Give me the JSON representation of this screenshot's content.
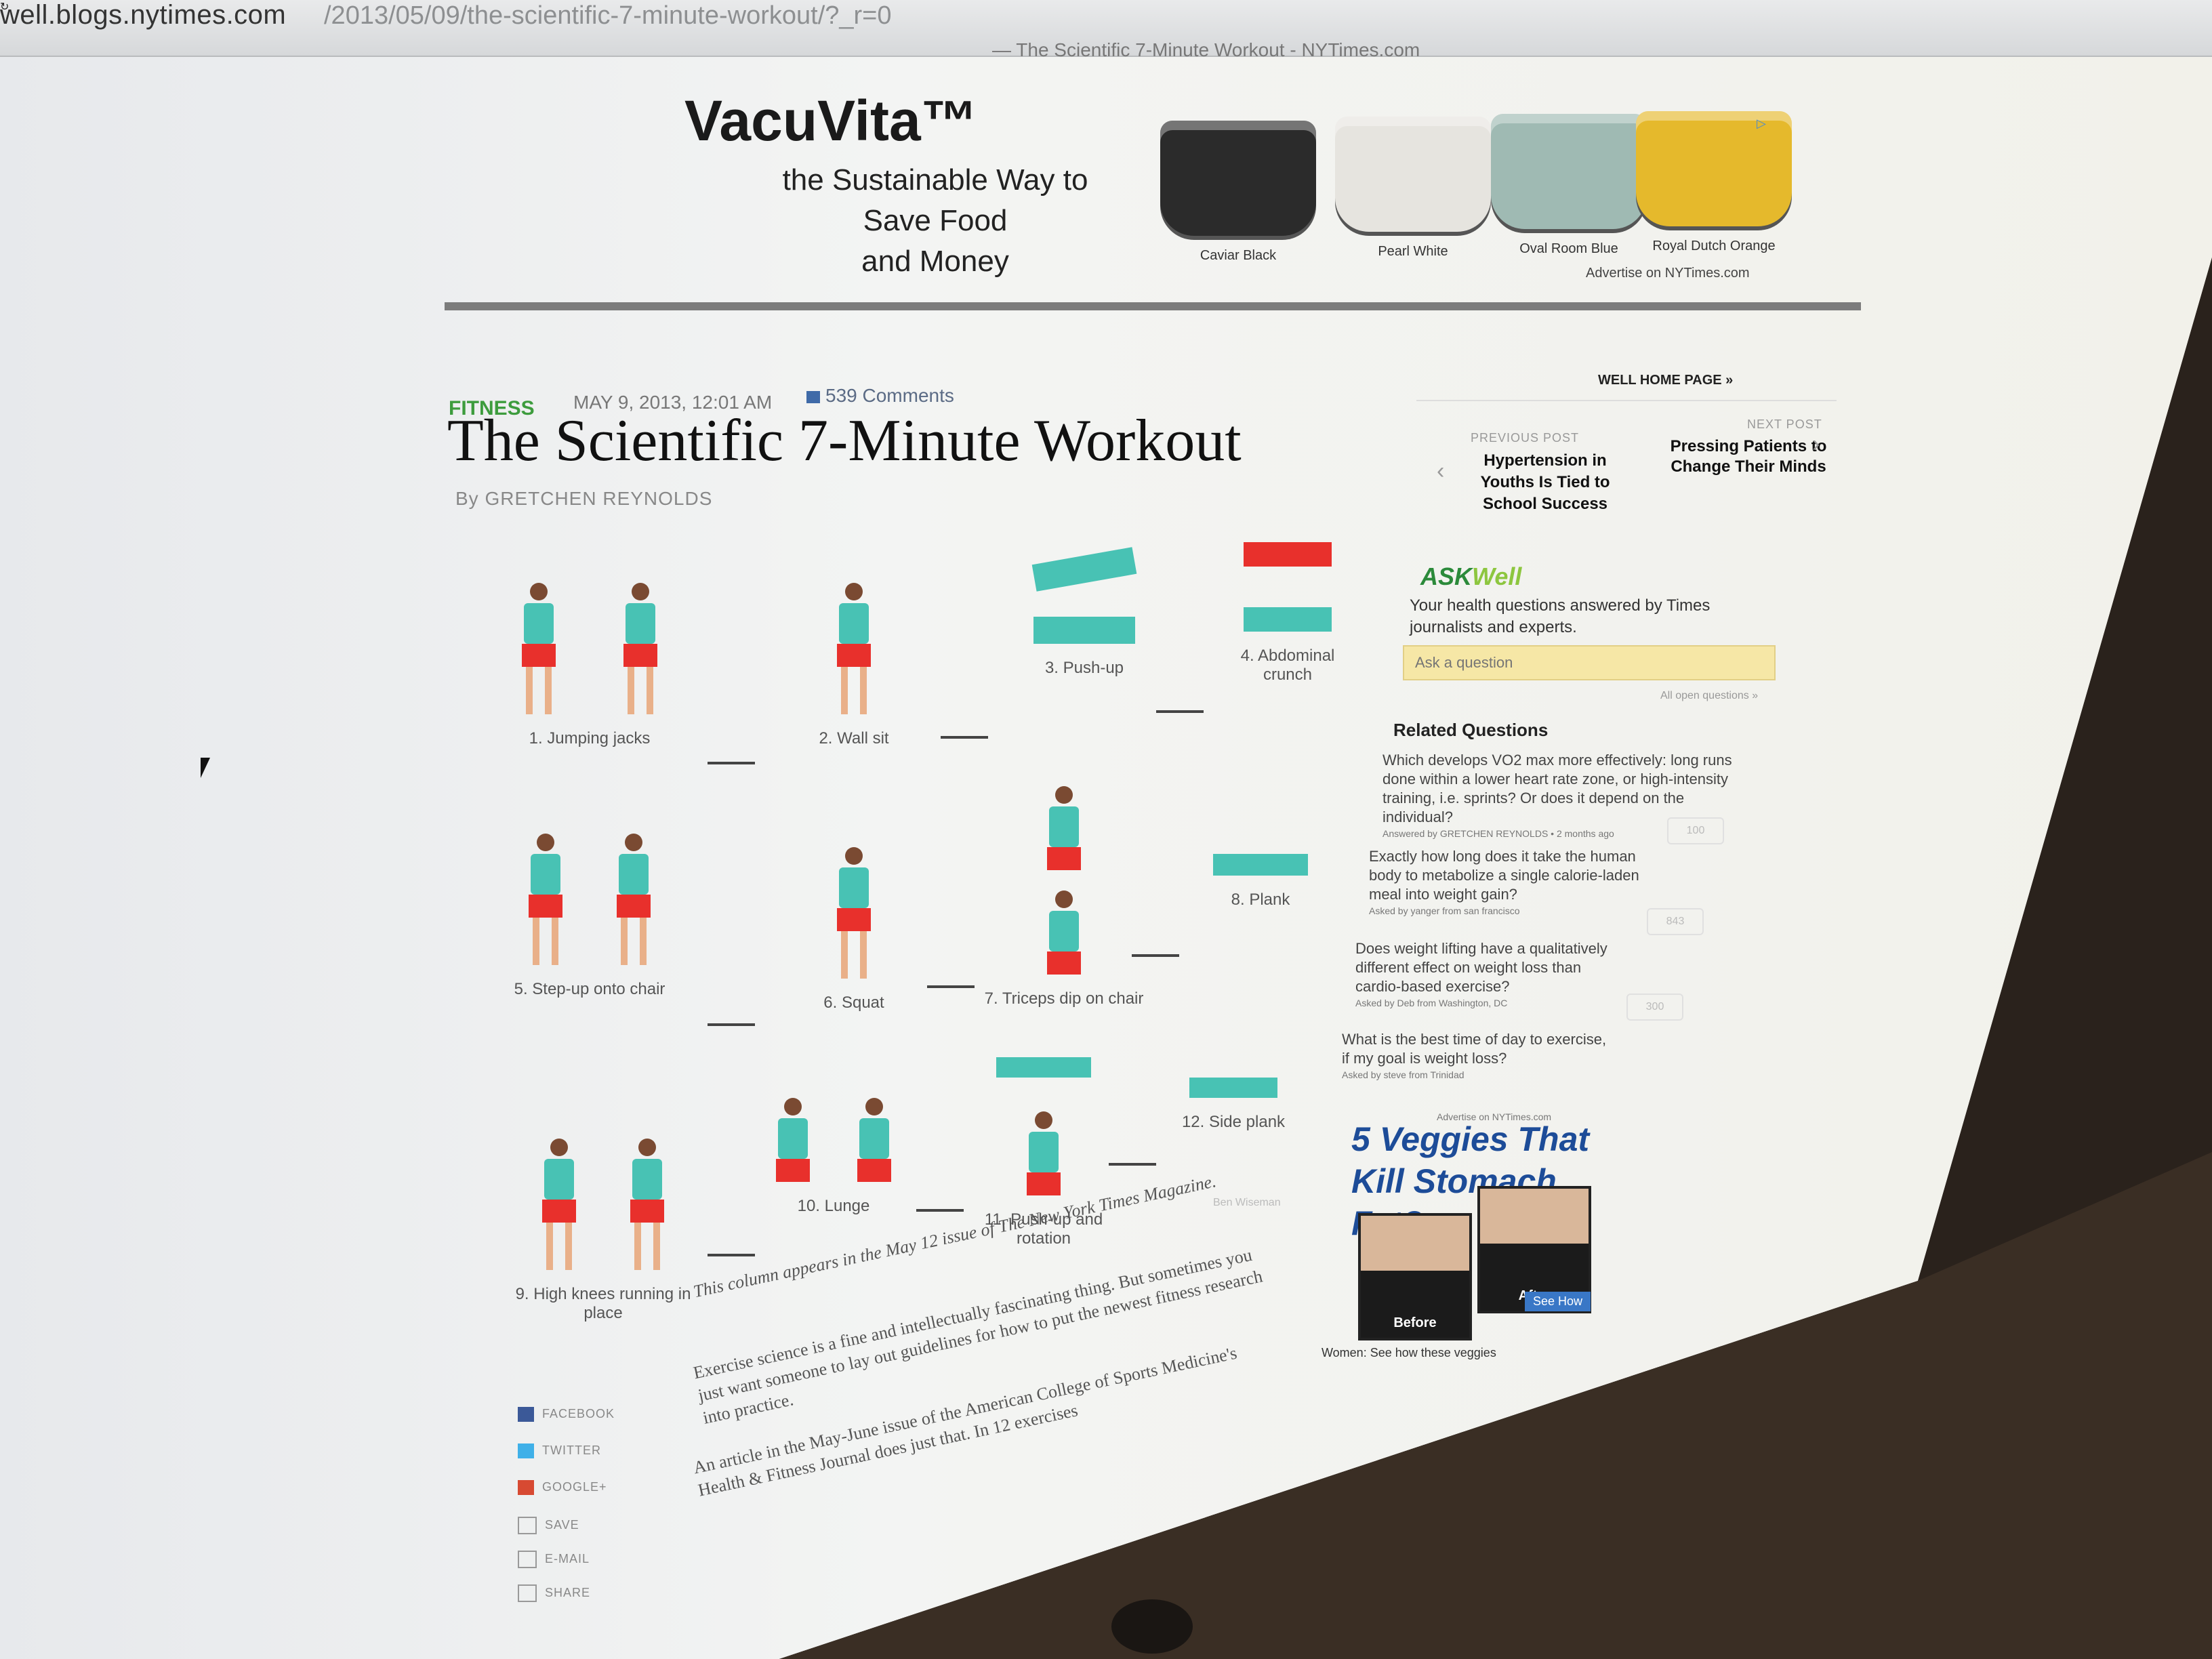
{
  "browser": {
    "url_host": "well.blogs.nytimes.com",
    "url_path": "/2013/05/09/the-scientific-7-minute-workout/?_r=0",
    "tab_title": "— The Scientific 7-Minute Workout - NYTimes.com",
    "reload_icon": "reload-icon"
  },
  "ad": {
    "brand": "VacuVita™",
    "tagline_1": "the Sustainable Way to Save Food",
    "tagline_2": "and Money",
    "products": [
      {
        "name": "Caviar Black",
        "color": "#2b2b2b"
      },
      {
        "name": "Pearl White",
        "color": "#e6e4df"
      },
      {
        "name": "Oval Room Blue",
        "color": "#9fbab3"
      },
      {
        "name": "Royal Dutch Orange",
        "color": "#e5b92c"
      }
    ],
    "footer": "Advertise on NYTimes.com",
    "adchoices": "▷"
  },
  "article": {
    "kicker": "FITNESS",
    "date": "MAY 9, 2013, 12:01 AM",
    "comments": "539 Comments",
    "headline": "The Scientific 7-Minute Workout",
    "byline": "By GRETCHEN REYNOLDS",
    "exercises": [
      "1. Jumping jacks",
      "2. Wall sit",
      "3. Push-up",
      "4. Abdominal crunch",
      "5. Step-up onto chair",
      "6. Squat",
      "7. Triceps dip on chair",
      "8. Plank",
      "9. High knees running in place",
      "10. Lunge",
      "11. Push-up and rotation",
      "12. Side plank"
    ],
    "photo_credit": "Ben Wiseman",
    "note": "This column appears in the May 12 issue of The New York Times Magazine.",
    "para1": "Exercise science is a fine and intellectually fascinating thing. But sometimes you just want someone to lay out guidelines for how to put the newest fitness research into practice.",
    "para2": "An article in the May-June issue of the American College of Sports Medicine's Health & Fitness Journal does just that. In 12 exercises"
  },
  "share": [
    "FACEBOOK",
    "TWITTER",
    "GOOGLE+",
    "SAVE",
    "E-MAIL",
    "SHARE"
  ],
  "sidebar": {
    "home": "WELL HOME PAGE »",
    "prev_label": "PREVIOUS POST",
    "prev_title": "Hypertension in Youths Is Tied to School Success",
    "next_label": "NEXT POST",
    "next_title": "Pressing Patients to Change Their Minds",
    "ask_a": "ASK",
    "ask_b": "Well",
    "ask_desc": "Your health questions answered by Times journalists and experts.",
    "ask_placeholder": "Ask a question",
    "all_open": "All open questions »",
    "related_title": "Related Questions",
    "questions": [
      {
        "text": "Which develops VO2 max more effectively: long runs done within a lower heart rate zone, or high-intensity training, i.e. sprints? Or does it depend on the individual?",
        "asked": "Answered by GRETCHEN REYNOLDS • 2 months ago",
        "votes": ""
      },
      {
        "text": "Exactly how long does it take the human body to metabolize a single calorie-laden meal into weight gain?",
        "asked": "Asked by yanger from san francisco",
        "votes": "100"
      },
      {
        "text": "Does weight lifting have a qualitatively different effect on weight loss than cardio-based exercise?",
        "asked": "Asked by Deb from Washington, DC",
        "votes": "843"
      },
      {
        "text": "What is the best time of day to exercise, if my goal is weight loss?",
        "asked": "Asked by steve from Trinidad",
        "votes": "300"
      }
    ]
  },
  "ad2": {
    "small": "Advertise on NYTimes.com",
    "headline": "5 Veggies That Kill Stomach Fat?",
    "before": "Before",
    "after": "After",
    "copy": "Women: See how these veggies",
    "button": "See How"
  }
}
